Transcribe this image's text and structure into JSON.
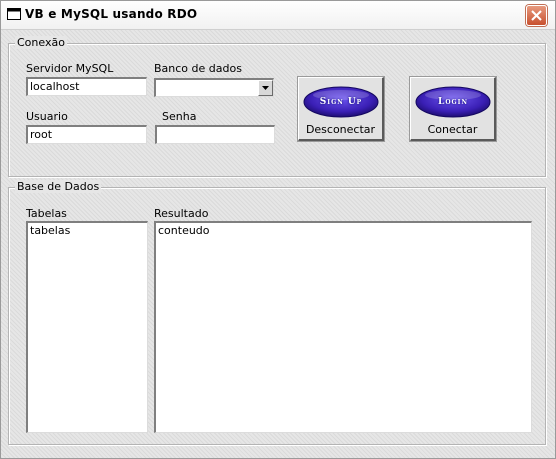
{
  "window": {
    "title": "VB e MySQL usando RDO"
  },
  "conexao": {
    "group_label": "Conexão",
    "servidor_label": "Servidor MySQL",
    "servidor_value": "localhost",
    "banco_label": "Banco de dados",
    "banco_value": "",
    "usuario_label": "Usuario",
    "usuario_value": "root",
    "senha_label": "Senha",
    "senha_value": "",
    "disconnect_button": {
      "image_text": "Sign Up",
      "caption": "Desconectar"
    },
    "connect_button": {
      "image_text": "Login",
      "caption": "Conectar"
    }
  },
  "base": {
    "group_label": "Base de Dados",
    "tabelas_label": "Tabelas",
    "tabelas_items": [
      "tabelas"
    ],
    "resultado_label": "Resultado",
    "resultado_items": [
      "conteudo"
    ]
  },
  "icons": {
    "window_icon": "window-icon",
    "close": "close-icon",
    "dropdown": "chevron-down-icon"
  },
  "colors": {
    "button_pill": "#3a1fb5",
    "close_button": "#d0603f"
  }
}
